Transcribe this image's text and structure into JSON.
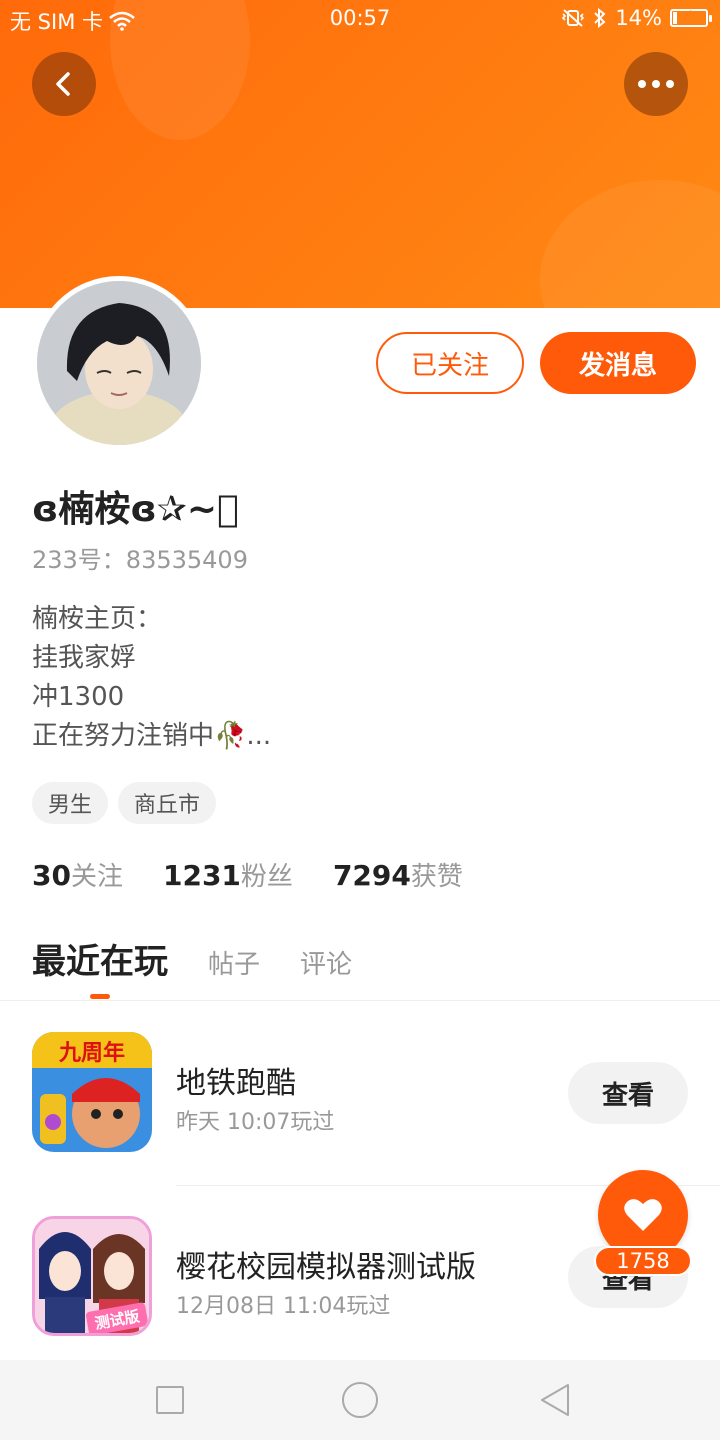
{
  "status_bar": {
    "carrier": "无 SIM 卡",
    "time": "00:57",
    "battery_percent": "14%",
    "battery_level": 0.14
  },
  "header": {
    "back_icon": "chevron-left-icon",
    "more_icon": "more-dots-icon",
    "banner_color": "#ff7a10"
  },
  "profile": {
    "followed_label": "已关注",
    "message_label": "发消息",
    "username": "ɞ楠桉ɞ✰~⃝",
    "uid": "233号：83535409",
    "bio": [
      "楠桉主页：",
      "挂我家娐",
      "冲1300",
      "正在努力注销中🥀..."
    ],
    "tags": [
      "男生",
      "商丘市"
    ],
    "stats": [
      {
        "count": "30",
        "label": "关注"
      },
      {
        "count": "1231",
        "label": "粉丝"
      },
      {
        "count": "7294",
        "label": "获赞"
      }
    ]
  },
  "tabs": [
    {
      "label": "最近在玩",
      "active": true
    },
    {
      "label": "帖子",
      "active": false
    },
    {
      "label": "评论",
      "active": false
    }
  ],
  "games": [
    {
      "name": "地铁跑酷",
      "time": "昨天 10:07玩过",
      "button": "查看",
      "icon_text": "九周年"
    },
    {
      "name": "樱花校园模拟器测试版",
      "time": "12月08日 11:04玩过",
      "button": "查看",
      "icon_text": "测试版"
    }
  ],
  "like": {
    "count": "1758"
  },
  "accent_color": "#ff5a0a"
}
